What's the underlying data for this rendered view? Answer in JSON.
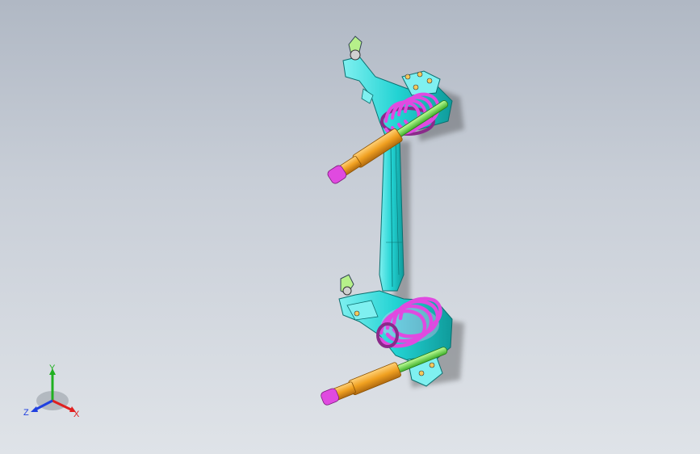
{
  "viewport": {
    "model": "rear-suspension-assembly",
    "colors": {
      "frame": "#22d3d3",
      "frame_dark": "#118a8a",
      "spring": "#e04ae0",
      "spring_dark": "#8a2a8a",
      "shock_body": "#f0a020",
      "shock_rod": "#66e04a",
      "bumper": "#e04ae0",
      "hub": "#c0c0c0"
    }
  },
  "triad": {
    "x_label": "X",
    "y_label": "Y",
    "z_label": "Z",
    "x_color": "#e02020",
    "y_color": "#20b020",
    "z_color": "#2040e0"
  }
}
